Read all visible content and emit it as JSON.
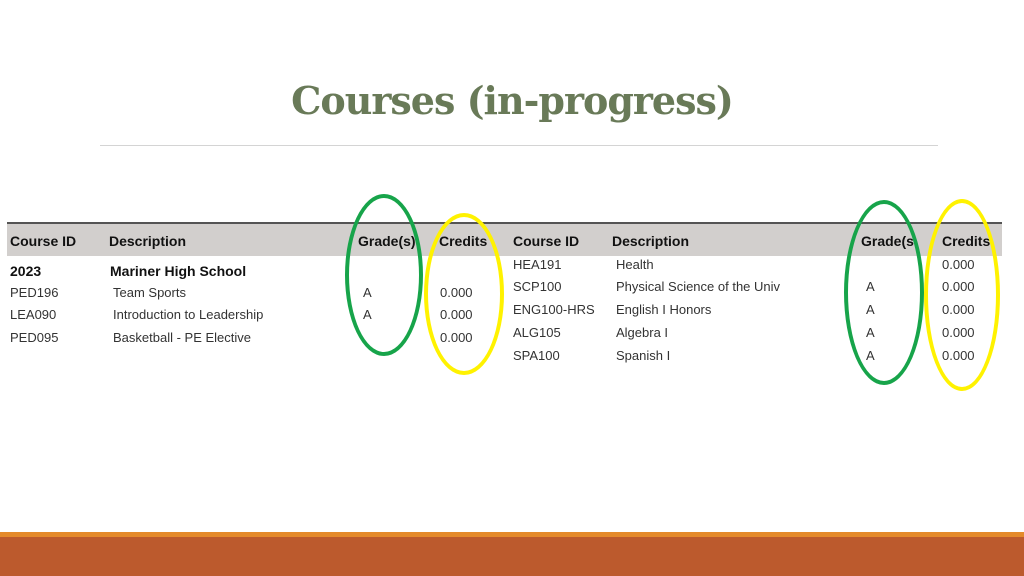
{
  "slide": {
    "title": "Courses (in-progress)"
  },
  "colors": {
    "title": "#697a58",
    "grade_highlight": "#17a44a",
    "credits_highlight": "#fff200",
    "footer": "#bc5a2d",
    "footer_stripe": "#e48a2b"
  },
  "left_table": {
    "headers": {
      "course_id": "Course ID",
      "description": "Description",
      "grades": "Grade(s)",
      "credits": "Credits"
    },
    "group": {
      "year": "2023",
      "school": "Mariner High School"
    },
    "rows": [
      {
        "course_id": "PED196",
        "description": "Team Sports",
        "grade": "A",
        "credits": "0.000"
      },
      {
        "course_id": "LEA090",
        "description": "Introduction to Leadership",
        "grade": "A",
        "credits": "0.000"
      },
      {
        "course_id": "PED095",
        "description": "Basketball - PE Elective",
        "grade": "",
        "credits": "0.000"
      }
    ]
  },
  "right_table": {
    "headers": {
      "course_id": "Course ID",
      "description": "Description",
      "grades": "Grade(s",
      "credits": "Credits"
    },
    "rows": [
      {
        "course_id": "HEA191",
        "description": "Health",
        "grade": "",
        "credits": "0.000"
      },
      {
        "course_id": "SCP100",
        "description": "Physical Science of the Univ",
        "grade": "A",
        "credits": "0.000"
      },
      {
        "course_id": "ENG100-HRS",
        "description": "English I Honors",
        "grade": "A",
        "credits": "0.000"
      },
      {
        "course_id": "ALG105",
        "description": "Algebra I",
        "grade": "A",
        "credits": "0.000"
      },
      {
        "course_id": "SPA100",
        "description": "Spanish I",
        "grade": "A",
        "credits": "0.000"
      }
    ]
  },
  "annotations": [
    {
      "shape": "oval",
      "color": "green",
      "marks": "left grades column"
    },
    {
      "shape": "oval",
      "color": "yellow",
      "marks": "left credits column"
    },
    {
      "shape": "oval",
      "color": "green",
      "marks": "right grades column"
    },
    {
      "shape": "oval",
      "color": "yellow",
      "marks": "right credits column"
    }
  ]
}
